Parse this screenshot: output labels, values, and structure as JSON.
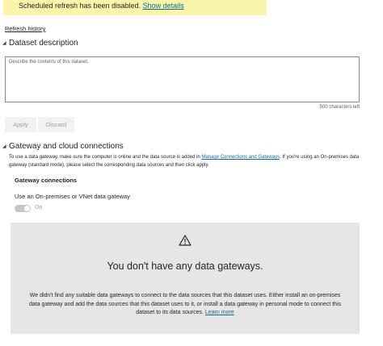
{
  "banner": {
    "text": "Scheduled refresh has been disabled.",
    "link": "Show details"
  },
  "refresh_history": "Refresh history",
  "dataset_description": {
    "title": "Dataset description",
    "placeholder": "Describe the contents of this dataset.",
    "chars_left": "500 characters left"
  },
  "buttons": {
    "apply": "Apply",
    "discard": "Discard"
  },
  "gateway": {
    "title": "Gateway and cloud connections",
    "desc_before": "To use a data gateway, make sure the computer is online and the data source is added in ",
    "desc_link": "Manage Connections and Gateways",
    "desc_after": ". If you're using an On-premises data gateway (standard mode), please select the corresponding data sources and then click apply.",
    "connections_heading": "Gateway connections",
    "toggle_label": "Use an On-premises or VNet data gateway",
    "toggle_state": "On"
  },
  "empty_state": {
    "icon": "warning-icon",
    "title": "You don't have any data gateways.",
    "text": "We didn't find any suitable data gateways to connect to the data sources that this dataset uses. Either install an on-premises data gateway and add the data sources that this dataset uses to it, or install a data gateway in personal mode to connect this dataset to its data sources.",
    "link": "Learn more"
  }
}
